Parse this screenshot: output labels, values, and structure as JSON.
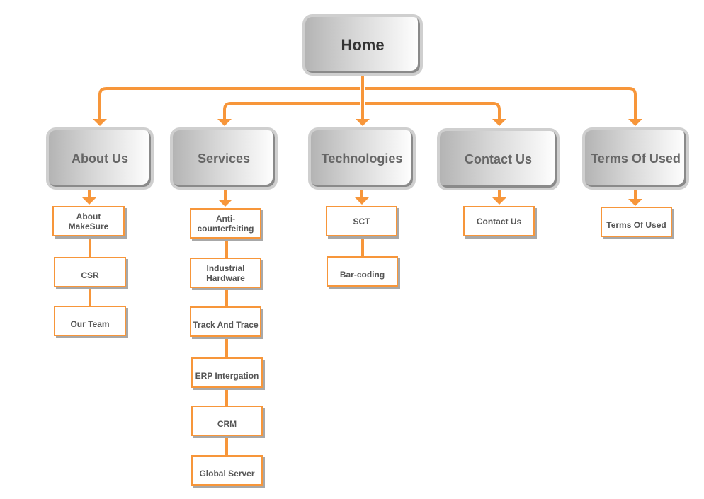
{
  "colors": {
    "connector": "#f7963a",
    "child_border": "#f7963a",
    "node_text": "#666666"
  },
  "root": {
    "label": "Home"
  },
  "sections": [
    {
      "label": "About Us",
      "children": [
        "About MakeSure",
        "CSR",
        "Our Team"
      ]
    },
    {
      "label": "Services",
      "children": [
        "Anti-counterfeiting",
        "Industrial Hardware",
        "Track And Trace",
        "ERP Intergation",
        "CRM",
        "Global Server"
      ]
    },
    {
      "label": "Technologies",
      "children": [
        "SCT",
        "Bar-coding"
      ]
    },
    {
      "label": "Contact Us",
      "children": [
        "Contact Us"
      ]
    },
    {
      "label": "Terms Of Used",
      "children": [
        "Terms Of Used"
      ]
    }
  ]
}
